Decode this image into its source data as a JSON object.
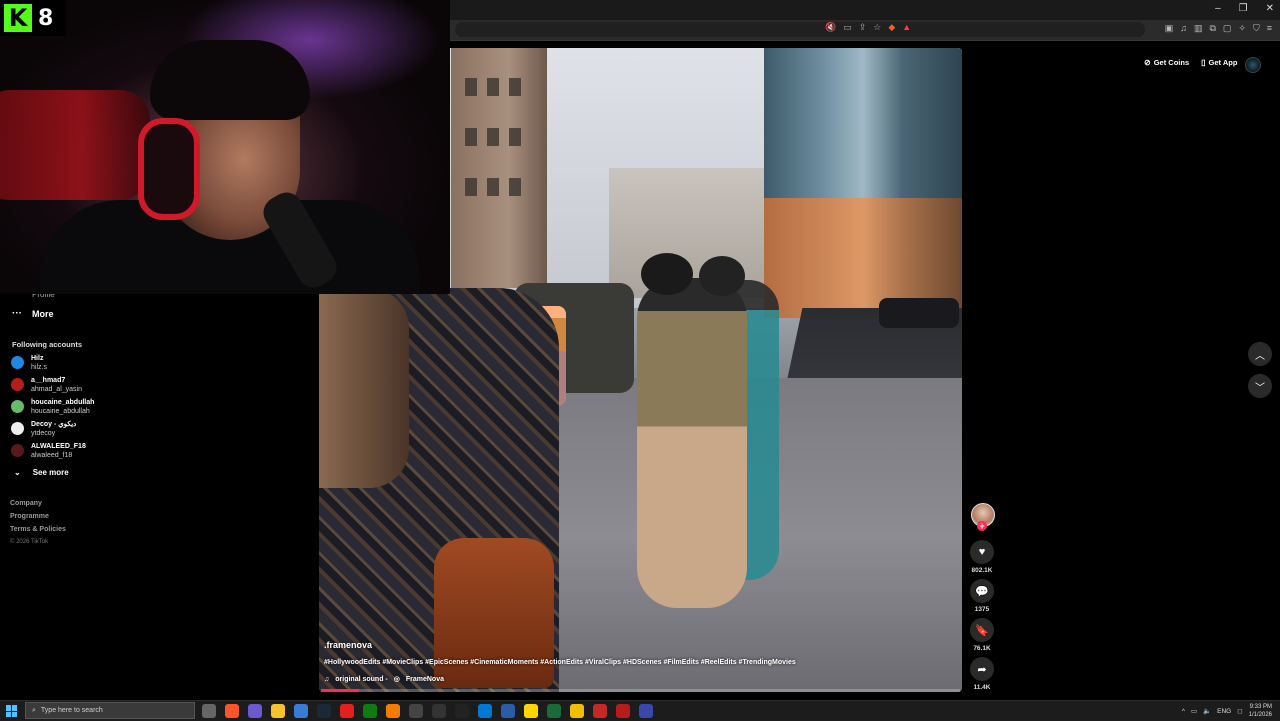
{
  "overlay": {
    "logo_letter": "K",
    "logo_number": "8"
  },
  "browser": {
    "window_controls": [
      "–",
      "❐",
      "✕"
    ]
  },
  "header": {
    "get_coins": "Get Coins",
    "get_app": "Get App"
  },
  "sidebar": {
    "cut_label": "Profile",
    "more": "More",
    "following_title": "Following accounts",
    "accounts": [
      {
        "name": "Hilz",
        "handle": "hilz.s",
        "color": "#1e88e5"
      },
      {
        "name": "a__hmad7",
        "handle": "ahmad_al_yasin",
        "color": "#b71c1c"
      },
      {
        "name": "houcaine_abdullah",
        "handle": "houcaine_abdullah",
        "color": "#66bb6a"
      },
      {
        "name": "Decoy - ديكوي",
        "handle": "ytdecoy",
        "color": "#eeeeee"
      },
      {
        "name": "ALWALEED_F18",
        "handle": "alwaleed_f18",
        "color": "#5a1a1a"
      }
    ],
    "see_more": "See more",
    "footer": [
      "Company",
      "Programme",
      "Terms & Policies"
    ],
    "copyright": "© 2026 TikTok"
  },
  "video": {
    "author": ".framenova",
    "hashtags": "#HollywoodEdits #MovieClips #EpicScenes #CinematicMoments #ActionEdits #ViralClips #HDScenes #FilmEdits #ReelEdits #TrendingMovies",
    "sound_label": "original sound -",
    "sound_author": "FrameNova",
    "progress": 0.06
  },
  "actions": {
    "likes": "802.1K",
    "comments": "1375",
    "saves": "76.1K",
    "shares": "11.4K"
  },
  "taskbar": {
    "search_placeholder": "Type here to search",
    "language": "ENG",
    "time": "9:33 PM",
    "date": "1/1/2026"
  },
  "colors": {
    "accent": "#fe2c55",
    "kick_green": "#53fc18"
  }
}
